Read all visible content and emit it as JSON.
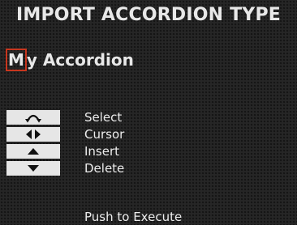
{
  "header": {
    "title": "IMPORT ACCORDION TYPE"
  },
  "name_field": {
    "cursor_char": "M",
    "rest": "y Accordion"
  },
  "controls": [
    {
      "icon": "rotate-icon",
      "label": "Select"
    },
    {
      "icon": "left-right-arrows-icon",
      "label": "Cursor"
    },
    {
      "icon": "up-arrow-icon",
      "label": "Insert"
    },
    {
      "icon": "down-arrow-icon",
      "label": "Delete"
    }
  ],
  "footer": {
    "execute_label": "Push to Execute"
  },
  "colors": {
    "background": "#262626",
    "text": "#e8e8e8",
    "cursor_border": "#c8361e",
    "key_background": "#e6e6e6"
  }
}
